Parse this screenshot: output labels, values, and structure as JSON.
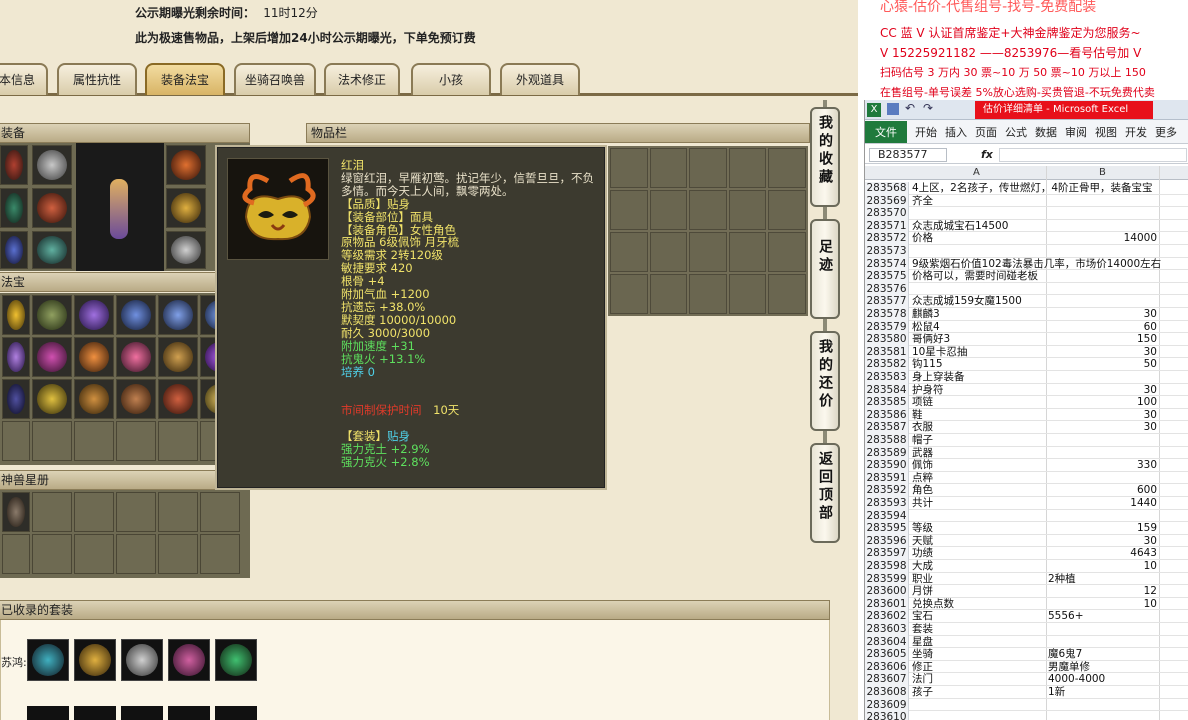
{
  "notice": {
    "line1_label": "公示期曝光剩余时间：",
    "line1_value": "11时12分",
    "line2": "此为极速售物品，上架后增加24小时公示期曝光，下单免预订费"
  },
  "tabs": [
    "本信息",
    "属性抗性",
    "装备法宝",
    "坐骑召唤兽",
    "法术修正",
    "小孩",
    "外观道具"
  ],
  "active_tab": 2,
  "panels": {
    "equip": "装备",
    "items": "物品栏",
    "fabao": "法宝",
    "shenshou": "神兽星册",
    "collected": "已收录的套装",
    "collected_label": "苏鸿:"
  },
  "side_buttons": [
    "我的收藏",
    "足迹",
    "我的还价",
    "返回顶部"
  ],
  "tooltip": {
    "name": "红泪",
    "desc": [
      "绿窗红泪，早雁初莺。扰记年少，信誓旦旦，不负",
      "多情。而今天上人间，飘零两处。"
    ],
    "rows": [
      {
        "text": "【品质】贴身",
        "color": "#f0e26a"
      },
      {
        "text": "【装备部位】面具",
        "color": "#f0e26a"
      },
      {
        "text": "【装备角色】女性角色",
        "color": "#f0e26a"
      },
      {
        "text": "原物品 6级佩饰 月牙梳",
        "color": "#f0e26a"
      },
      {
        "text": "等级需求 2转120级",
        "color": "#f0e26a"
      },
      {
        "text": "敏捷要求 420",
        "color": "#f0e26a"
      },
      {
        "text": "根骨 +4",
        "color": "#f0e26a"
      },
      {
        "text": "附加气血 +1200",
        "color": "#f0e26a"
      },
      {
        "text": "抗遗忘 +38.0%",
        "color": "#f0e26a"
      },
      {
        "text": "默契度 10000/10000",
        "color": "#f0e26a"
      },
      {
        "text": "耐久 3000/3000",
        "color": "#f0e26a"
      },
      {
        "text": "附加速度 +31",
        "color": "#5ee05e"
      },
      {
        "text": "抗鬼火 +13.1%",
        "color": "#5ee05e"
      },
      {
        "text": "培养 0",
        "color": "#4fd0e8"
      }
    ],
    "protect_label": "市间制保护时间",
    "protect_value": "10天",
    "set_label": "【套装】",
    "set_value": "贴身",
    "set_rows": [
      "强力克土 +2.9%",
      "强力克火 +2.8%"
    ]
  },
  "promo": [
    "心猿-估价-代售组号-找号-免费配装",
    "CC 蓝 V 认证首席鉴定+大神金牌鉴定为您服务~",
    "V 15225921182 ——8253976—看号估号加 V",
    "扫码估号 3 万内 30 票~10 万 50 票~10 万以上 150",
    "在售组号-单号误差 5%放心选购-买贵管退-不玩免费代卖"
  ],
  "excel": {
    "title": "估价详细清单 - Microsoft Excel",
    "ribbon_tabs": [
      "文件",
      "开始",
      "插入",
      "页面",
      "公式",
      "数据",
      "审阅",
      "视图",
      "开发",
      "更多"
    ],
    "namebox": "B283577",
    "fx": "fx",
    "col_a": "A",
    "col_b": "B",
    "rows": [
      {
        "n": "283568",
        "a": "4上区，2名孩子，传世燃灯，4阶正骨甲，装备宝宝",
        "b": ""
      },
      {
        "n": "283569",
        "a": "齐全",
        "b": ""
      },
      {
        "n": "283570",
        "a": "",
        "b": ""
      },
      {
        "n": "283571",
        "a": "众志成城宝石14500",
        "b": ""
      },
      {
        "n": "283572",
        "a": "价格",
        "b": "14000"
      },
      {
        "n": "283573",
        "a": "",
        "b": ""
      },
      {
        "n": "283574",
        "a": "9级紫烟石价值102毒法暴击几率，市场价14000左右",
        "b": ""
      },
      {
        "n": "283575",
        "a": "价格可以，需要时间碰老板",
        "b": ""
      },
      {
        "n": "283576",
        "a": "",
        "b": ""
      },
      {
        "n": "283577",
        "a": "众志成城159女魔1500",
        "b": ""
      },
      {
        "n": "283578",
        "a": "麒麟3",
        "b": "30"
      },
      {
        "n": "283579",
        "a": "松鼠4",
        "b": "60"
      },
      {
        "n": "283580",
        "a": "哥俩好3",
        "b": "150"
      },
      {
        "n": "283581",
        "a": "10星卡忍抽",
        "b": "30"
      },
      {
        "n": "283582",
        "a": "钩115",
        "b": "50"
      },
      {
        "n": "283583",
        "a": "身上穿装备",
        "b": ""
      },
      {
        "n": "283584",
        "a": "护身符",
        "b": "30"
      },
      {
        "n": "283585",
        "a": "项链",
        "b": "100"
      },
      {
        "n": "283586",
        "a": "鞋",
        "b": "30"
      },
      {
        "n": "283587",
        "a": "衣服",
        "b": "30"
      },
      {
        "n": "283588",
        "a": "帽子",
        "b": ""
      },
      {
        "n": "283589",
        "a": "武器",
        "b": ""
      },
      {
        "n": "283590",
        "a": "佩饰",
        "b": "330"
      },
      {
        "n": "283591",
        "a": "点粹",
        "b": ""
      },
      {
        "n": "283592",
        "a": "角色",
        "b": "600"
      },
      {
        "n": "283593",
        "a": "共计",
        "b": "1440"
      },
      {
        "n": "283594",
        "a": "",
        "b": ""
      },
      {
        "n": "283595",
        "a": "等级",
        "b": "159"
      },
      {
        "n": "283596",
        "a": "天赋",
        "b": "30"
      },
      {
        "n": "283597",
        "a": "功绩",
        "b": "4643"
      },
      {
        "n": "283598",
        "a": "大成",
        "b": "10"
      },
      {
        "n": "283599",
        "a": "职业",
        "b": "2种植",
        "bl": true
      },
      {
        "n": "283600",
        "a": "月饼",
        "b": "12"
      },
      {
        "n": "283601",
        "a": "兑换点数",
        "b": "10"
      },
      {
        "n": "283602",
        "a": "宝石",
        "b": "5556+",
        "bl": true
      },
      {
        "n": "283603",
        "a": "套装",
        "b": ""
      },
      {
        "n": "283604",
        "a": "星盘",
        "b": ""
      },
      {
        "n": "283605",
        "a": "坐骑",
        "b": "魔6鬼7",
        "bl": true
      },
      {
        "n": "283606",
        "a": "修正",
        "b": "男魔单修",
        "bl": true
      },
      {
        "n": "283607",
        "a": "法门",
        "b": "4000-4000",
        "bl": true
      },
      {
        "n": "283608",
        "a": "孩子",
        "b": "1新",
        "bl": true
      },
      {
        "n": "283609",
        "a": "",
        "b": ""
      },
      {
        "n": "283610",
        "a": "",
        "b": ""
      }
    ]
  }
}
